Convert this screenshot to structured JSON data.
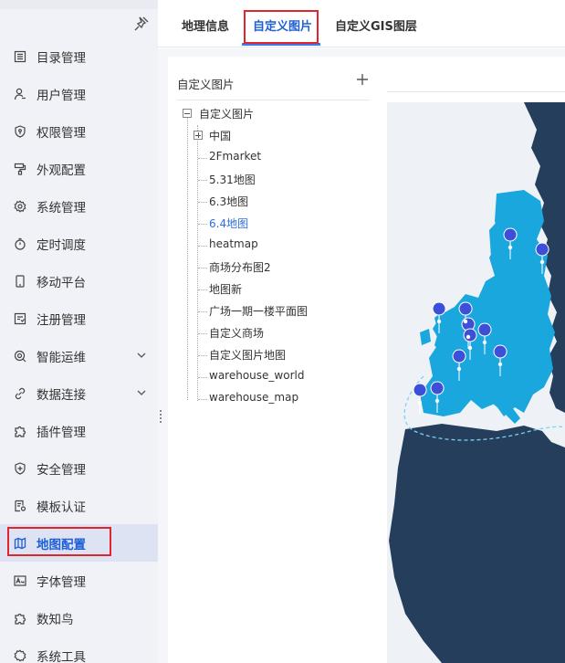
{
  "sidebar": {
    "items": [
      {
        "label": "目录管理",
        "icon": "catalog-icon"
      },
      {
        "label": "用户管理",
        "icon": "user-icon"
      },
      {
        "label": "权限管理",
        "icon": "shield-key-icon"
      },
      {
        "label": "外观配置",
        "icon": "paint-roller-icon"
      },
      {
        "label": "系统管理",
        "icon": "gear-icon"
      },
      {
        "label": "定时调度",
        "icon": "timer-icon"
      },
      {
        "label": "移动平台",
        "icon": "mobile-icon"
      },
      {
        "label": "注册管理",
        "icon": "registration-icon"
      },
      {
        "label": "智能运维",
        "icon": "smart-ops-icon"
      },
      {
        "label": "数据连接",
        "icon": "link-icon"
      },
      {
        "label": "插件管理",
        "icon": "puzzle-icon"
      },
      {
        "label": "安全管理",
        "icon": "shield-plus-icon"
      },
      {
        "label": "模板认证",
        "icon": "template-cert-icon"
      },
      {
        "label": "地图配置",
        "icon": "map-icon"
      },
      {
        "label": "字体管理",
        "icon": "font-icon"
      },
      {
        "label": "数知鸟",
        "icon": "bird-icon"
      },
      {
        "label": "系统工具",
        "icon": "tools-icon"
      }
    ]
  },
  "tabs": [
    {
      "label": "地理信息"
    },
    {
      "label": "自定义图片"
    },
    {
      "label": "自定义GIS图层"
    }
  ],
  "tree": {
    "header": "自定义图片",
    "root": "自定义图片",
    "children": [
      "中国",
      "2Fmarket",
      "5.31地图",
      "6.3地图",
      "6.4地图",
      "heatmap",
      "商场分布图2",
      "地图新",
      "广场一期一楼平面图",
      "自定义商场",
      "自定义图片地图",
      "warehouse_world",
      "warehouse_map"
    ],
    "selected": "6.4地图"
  },
  "colors": {
    "accent": "#1f5fd6",
    "highlight_box": "#e0262c",
    "map_ocean": "#eef1f6",
    "map_dark_land": "#243e5c",
    "map_light_land": "#19a7de",
    "pin": "#3d4fd8"
  }
}
